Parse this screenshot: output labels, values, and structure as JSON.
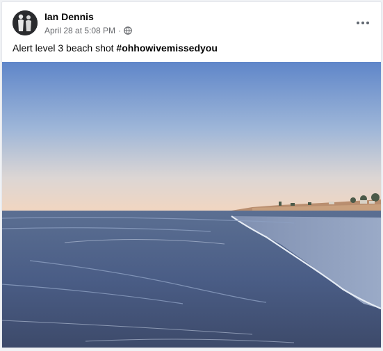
{
  "post": {
    "author": "Ian Dennis",
    "timestamp": "April 28 at 5:08 PM",
    "separator": "·",
    "privacy_icon": "globe-icon",
    "menu_icon": "more-options-icon",
    "caption_text": "Alert level 3 beach shot ",
    "caption_hashtag": "#ohhowivemissedyou",
    "photo_subject": "beach-at-sunset"
  },
  "colors": {
    "author_text": "#050505",
    "meta_text": "#65676b",
    "sky_top": "#5f86c9",
    "sky_horizon": "#f1d6c1",
    "sea": "#4a5d86"
  }
}
